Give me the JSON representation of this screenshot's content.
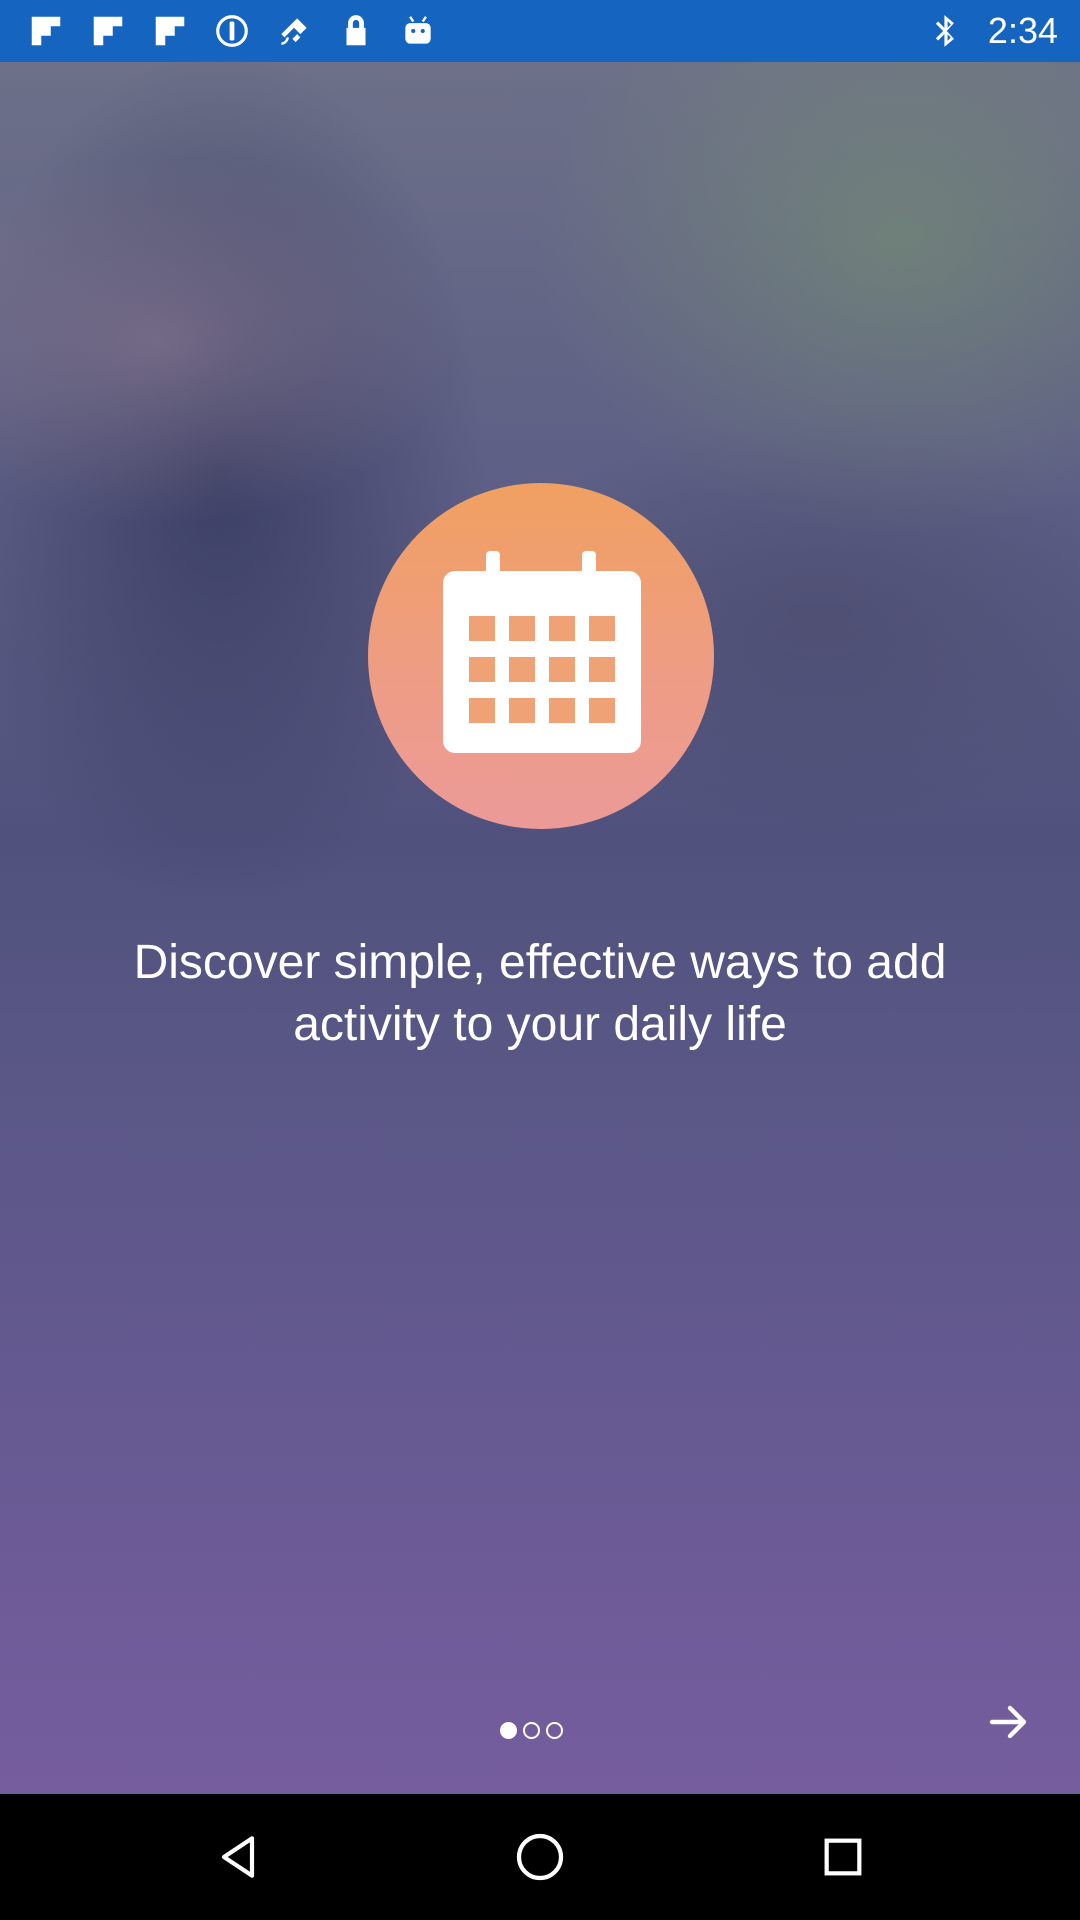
{
  "status_bar": {
    "time": "2:34",
    "icons_left": [
      "flipboard-icon",
      "flipboard-icon",
      "flipboard-icon",
      "info-icon",
      "fake-gps-icon",
      "lock-icon",
      "android-icon"
    ],
    "icons_right": [
      "bluetooth-icon"
    ],
    "background_color": "#1565c0"
  },
  "onboarding": {
    "illustration_icon": "calendar-icon",
    "headline": "Discover simple, effective ways to add activity to your daily life",
    "pager": {
      "current_page": 1,
      "total_pages": 3
    },
    "next_icon": "arrow-right-icon",
    "accent_color": "#ee9d84"
  },
  "nav_bar": {
    "buttons": [
      "back-icon",
      "home-icon",
      "recents-icon"
    ]
  }
}
